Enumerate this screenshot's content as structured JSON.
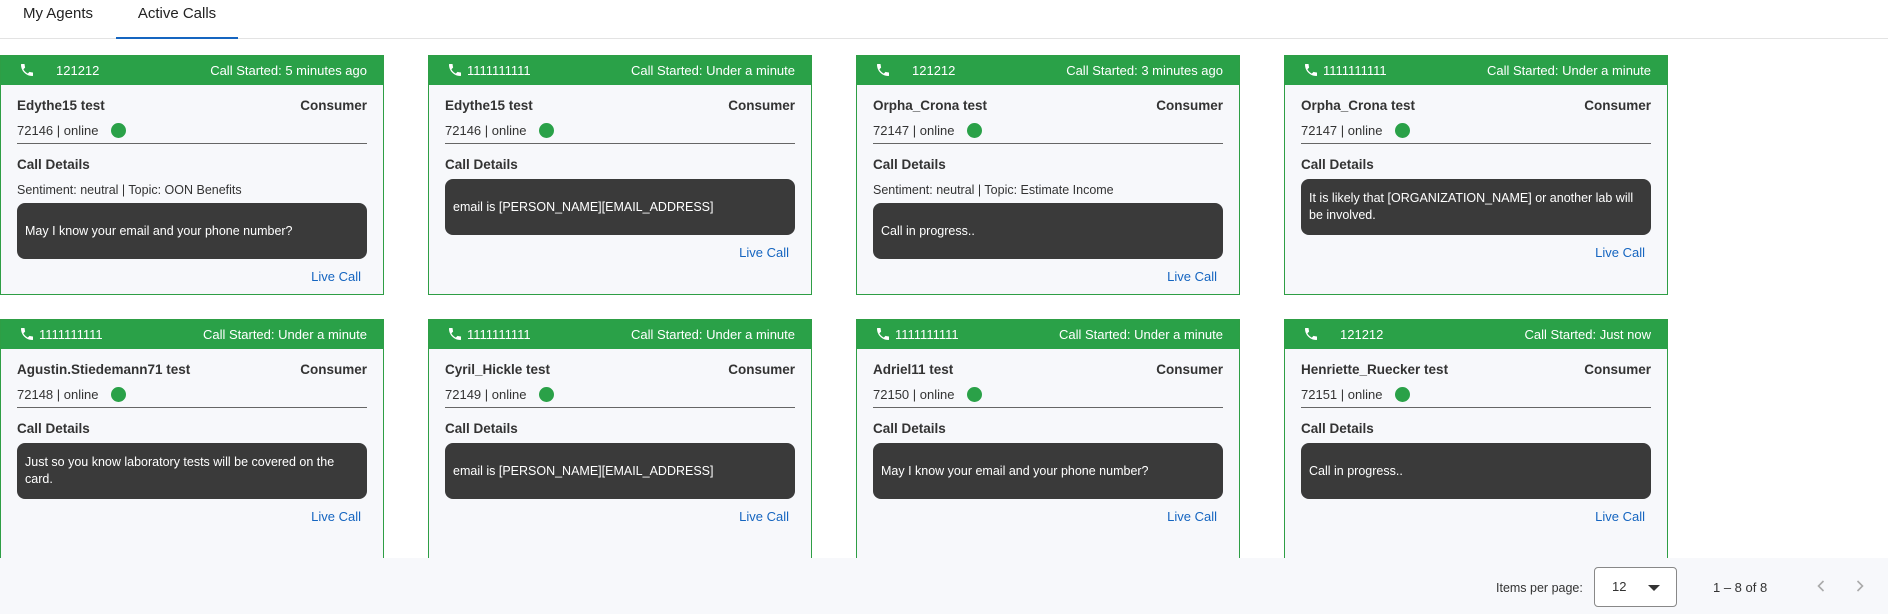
{
  "tabs": [
    {
      "label": "My Agents",
      "active": false
    },
    {
      "label": "Active Calls",
      "active": true
    }
  ],
  "colors": {
    "accent": "#2aa148",
    "link": "#1565c0",
    "bubble": "#3a3a3a",
    "tab_underline": "#1565c0"
  },
  "cards": [
    {
      "number": "121212",
      "started": "Call Started: 5 minutes ago",
      "agent_name": "Edythe15 test",
      "role": "Consumer",
      "agent_status": "72146 | online",
      "details_label": "Call Details",
      "meta": "Sentiment: neutral |  Topic: OON Benefits",
      "message": "May I know your email and your phone number?",
      "link": "Live Call"
    },
    {
      "number": "1111111111",
      "started": "Call Started: Under a minute",
      "agent_name": "Edythe15 test",
      "role": "Consumer",
      "agent_status": "72146 | online",
      "details_label": "Call Details",
      "meta": "",
      "message": "email is [PERSON_NAME][EMAIL_ADDRESS]",
      "link": "Live Call"
    },
    {
      "number": "121212",
      "started": "Call Started: 3 minutes ago",
      "agent_name": "Orpha_Crona test",
      "role": "Consumer",
      "agent_status": "72147 | online",
      "details_label": "Call Details",
      "meta": "Sentiment: neutral |  Topic: Estimate Income",
      "message": "Call in progress..",
      "link": "Live Call"
    },
    {
      "number": "1111111111",
      "started": "Call Started: Under a minute",
      "agent_name": "Orpha_Crona test",
      "role": "Consumer",
      "agent_status": "72147 | online",
      "details_label": "Call Details",
      "meta": "",
      "message": "It is likely that [ORGANIZATION_NAME] or another lab will be involved.",
      "link": "Live Call"
    },
    {
      "number": "1111111111",
      "started": "Call Started: Under a minute",
      "agent_name": "Agustin.Stiedemann71 test",
      "role": "Consumer",
      "agent_status": "72148 | online",
      "details_label": "Call Details",
      "meta": "",
      "message": "Just so you know laboratory tests will be covered on the card.",
      "link": "Live Call"
    },
    {
      "number": "1111111111",
      "started": "Call Started: Under a minute",
      "agent_name": "Cyril_Hickle test",
      "role": "Consumer",
      "agent_status": "72149 | online",
      "details_label": "Call Details",
      "meta": "",
      "message": "email is [PERSON_NAME][EMAIL_ADDRESS]",
      "link": "Live Call"
    },
    {
      "number": "1111111111",
      "started": "Call Started: Under a minute",
      "agent_name": "Adriel11 test",
      "role": "Consumer",
      "agent_status": "72150 | online",
      "details_label": "Call Details",
      "meta": "",
      "message": "May I know your email and your phone number?",
      "link": "Live Call"
    },
    {
      "number": "121212",
      "started": "Call Started: Just now",
      "agent_name": "Henriette_Ruecker test",
      "role": "Consumer",
      "agent_status": "72151 | online",
      "details_label": "Call Details",
      "meta": "",
      "message": "Call in progress..",
      "link": "Live Call"
    }
  ],
  "paginator": {
    "items_per_page_label": "Items per page:",
    "items_per_page_value": "12",
    "range_label": "1 – 8 of 8",
    "prev_icon": "chevron-left-icon",
    "next_icon": "chevron-right-icon"
  }
}
